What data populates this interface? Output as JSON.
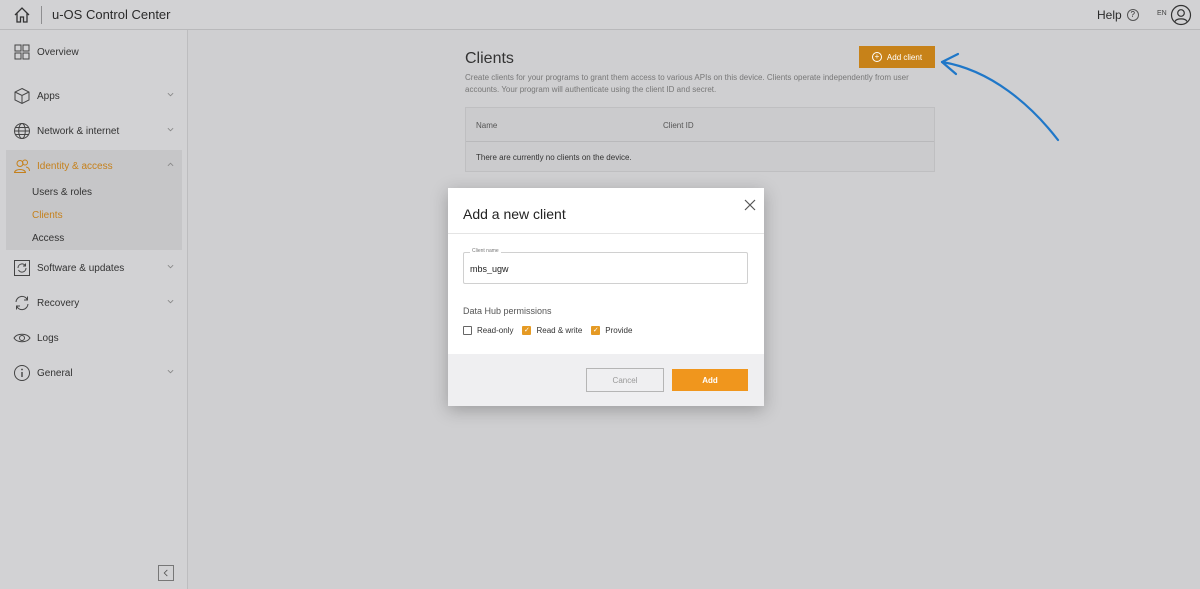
{
  "header": {
    "title": "u-OS Control Center",
    "help_label": "Help",
    "help_icon_glyph": "?",
    "language": "EN"
  },
  "sidebar": {
    "items": [
      {
        "label": "Overview",
        "icon": "grid-icon"
      },
      {
        "label": "Apps",
        "icon": "cube-icon"
      },
      {
        "label": "Network & internet",
        "icon": "globe-icon"
      },
      {
        "label": "Identity & access",
        "icon": "users-icon",
        "expanded": true
      },
      {
        "label": "Software & updates",
        "icon": "refresh-box-icon"
      },
      {
        "label": "Recovery",
        "icon": "recovery-icon"
      },
      {
        "label": "Logs",
        "icon": "eye-icon"
      },
      {
        "label": "General",
        "icon": "info-icon"
      }
    ],
    "subitems": [
      {
        "label": "Users & roles"
      },
      {
        "label": "Clients",
        "active": true
      },
      {
        "label": "Access"
      }
    ]
  },
  "main": {
    "title": "Clients",
    "add_button_label": "Add client",
    "description": "Create clients for your programs to grant them access to various APIs on this device. Clients operate independently from user accounts. Your program will authenticate using the client ID and secret.",
    "table": {
      "columns": [
        "Name",
        "Client ID"
      ],
      "empty_text": "There are currently no clients on the device."
    }
  },
  "modal": {
    "title": "Add a new client",
    "client_name_label": "Client name",
    "client_name_value": "mbs_ugw",
    "permissions_title": "Data Hub permissions",
    "permissions": [
      {
        "label": "Read-only",
        "checked": false
      },
      {
        "label": "Read & write",
        "checked": true
      },
      {
        "label": "Provide",
        "checked": true
      }
    ],
    "cancel_label": "Cancel",
    "add_label": "Add"
  },
  "colors": {
    "accent": "#e59a24",
    "accent_dimmed": "#c78219",
    "annotation_arrow": "#1f77c8"
  }
}
